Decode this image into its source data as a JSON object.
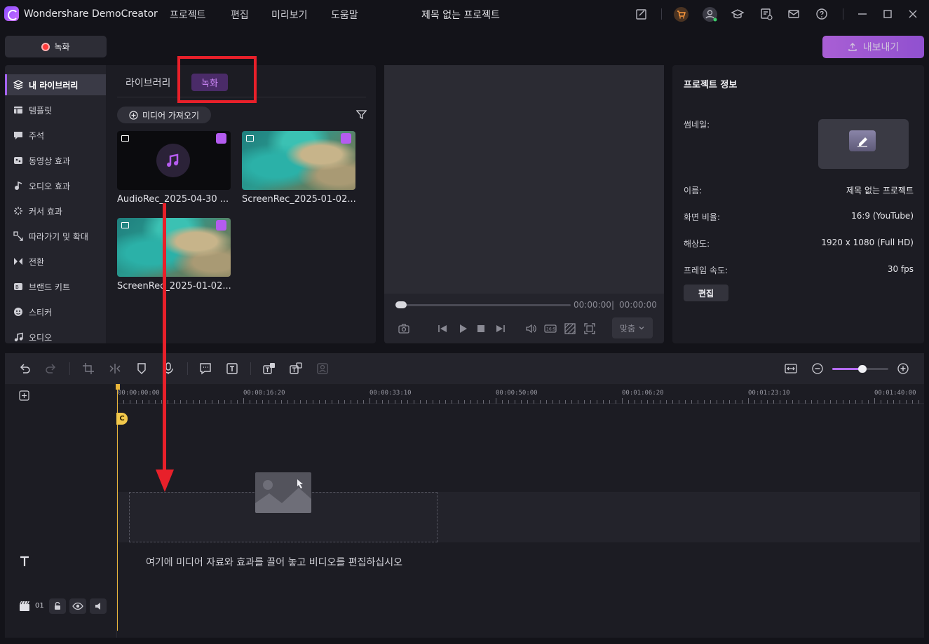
{
  "titlebar": {
    "app_title": "Wondershare DemoCreator",
    "menus": [
      "프로젝트",
      "편집",
      "미리보기",
      "도움말"
    ],
    "project_title": "제목 없는 프로젝트",
    "icons": [
      "feedback-icon",
      "cart-icon",
      "account-icon",
      "learn-icon",
      "tasks-icon",
      "mail-icon",
      "help-icon",
      "minimize-icon",
      "maximize-icon",
      "close-icon"
    ]
  },
  "actions": {
    "record_label": "녹화",
    "export_label": "내보내기"
  },
  "sidebar": {
    "items": [
      {
        "label": "내 라이브러리",
        "icon": "layers-icon",
        "active": true
      },
      {
        "label": "템플릿",
        "icon": "template-icon"
      },
      {
        "label": "주석",
        "icon": "annotation-icon"
      },
      {
        "label": "동영상 효과",
        "icon": "video-effect-icon"
      },
      {
        "label": "오디오 효과",
        "icon": "audio-effect-icon"
      },
      {
        "label": "커서 효과",
        "icon": "cursor-effect-icon"
      },
      {
        "label": "따라가기 및 확대",
        "icon": "pan-zoom-icon"
      },
      {
        "label": "전환",
        "icon": "transition-icon"
      },
      {
        "label": "브랜드 키트",
        "icon": "brand-kit-icon"
      },
      {
        "label": "스티커",
        "icon": "sticker-icon"
      },
      {
        "label": "오디오",
        "icon": "audio-icon"
      }
    ]
  },
  "library": {
    "tabs": [
      "라이브러리",
      "녹화"
    ],
    "active_tab": "녹화",
    "import_label": "미디어 가져오기",
    "media": [
      {
        "name": "AudioRec_2025-04-30 ...",
        "kind": "audio"
      },
      {
        "name": "ScreenRec_2025-01-02...",
        "kind": "video"
      },
      {
        "name": "ScreenRec_2025-01-02...",
        "kind": "video"
      }
    ]
  },
  "preview": {
    "current_time": "00:00:00",
    "total_time": "00:00:00",
    "fit_label": "맞춤"
  },
  "project_info": {
    "title": "프로젝트 정보",
    "thumbnail_label": "썸네일:",
    "fields": [
      {
        "label": "이름:",
        "value": "제목 없는 프로젝트"
      },
      {
        "label": "화면 비율:",
        "value": "16:9 (YouTube)"
      },
      {
        "label": "해상도:",
        "value": "1920 x 1080 (Full HD)"
      },
      {
        "label": "프레임 속도:",
        "value": "30 fps"
      }
    ],
    "edit_label": "편집"
  },
  "timeline": {
    "ruler_labels": [
      "00:00:00:00",
      "00:00:16:20",
      "00:00:33:10",
      "00:00:50:00",
      "00:01:06:20",
      "00:01:23:10",
      "00:01:40:00"
    ],
    "hint": "여기에 미디어 자료와 효과를 끌어 놓고 비디오를 편집하십시오",
    "track_number": "01",
    "playhead_marker": "C"
  },
  "colors": {
    "accent": "#a563ff",
    "annotation_red": "#e8202a",
    "playhead": "#e8b53a"
  }
}
